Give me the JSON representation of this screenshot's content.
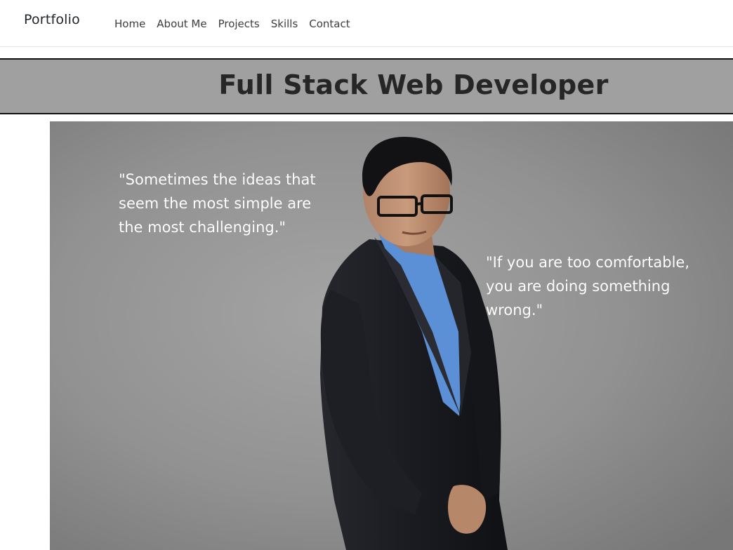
{
  "navbar": {
    "brand": "Portfolio",
    "links": [
      "Home",
      "About Me",
      "Projects",
      "Skills",
      "Contact"
    ]
  },
  "header": {
    "title": "Full Stack Web Developer"
  },
  "hero": {
    "quote_left": "\"Sometimes the ideas that seem the most simple are the most challenging.\"",
    "quote_right": "\"If you are too comfortable, you are doing something wrong.\""
  },
  "colors": {
    "title_band": "#a0a0a0",
    "hero_background": "#939393",
    "shirt": "#5b8fd6",
    "suit": "#1c1d22"
  }
}
